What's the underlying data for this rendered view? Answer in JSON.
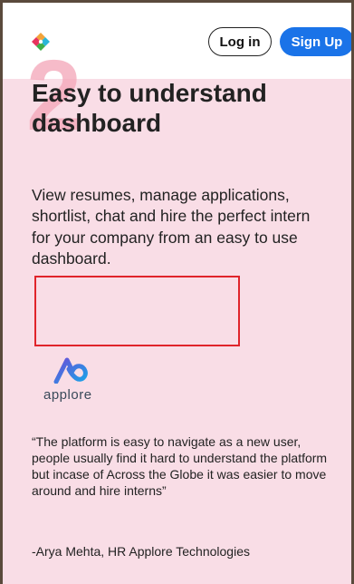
{
  "header": {
    "login_label": "Log in",
    "signup_label": "Sign Up",
    "logo_icon": "colorful-diamond-logo-icon"
  },
  "step": {
    "number": "2"
  },
  "feature": {
    "title": "Easy to understand dashboard",
    "description": "View resumes, manage applications, shortlist, chat and hire the perfect intern for your company from an easy to use dashboard."
  },
  "testimonial": {
    "company_logo_text": "applore",
    "quote": "“The platform is easy to navigate as a new user, people usually find it hard to understand the platform but incase of Across the Globe it was easier to move around and hire interns”",
    "author": "-Arya Mehta, HR Applore Technologies"
  },
  "colors": {
    "background": "#f9dde6",
    "accent": "#1a73e8",
    "highlight_box": "#e0242b"
  }
}
